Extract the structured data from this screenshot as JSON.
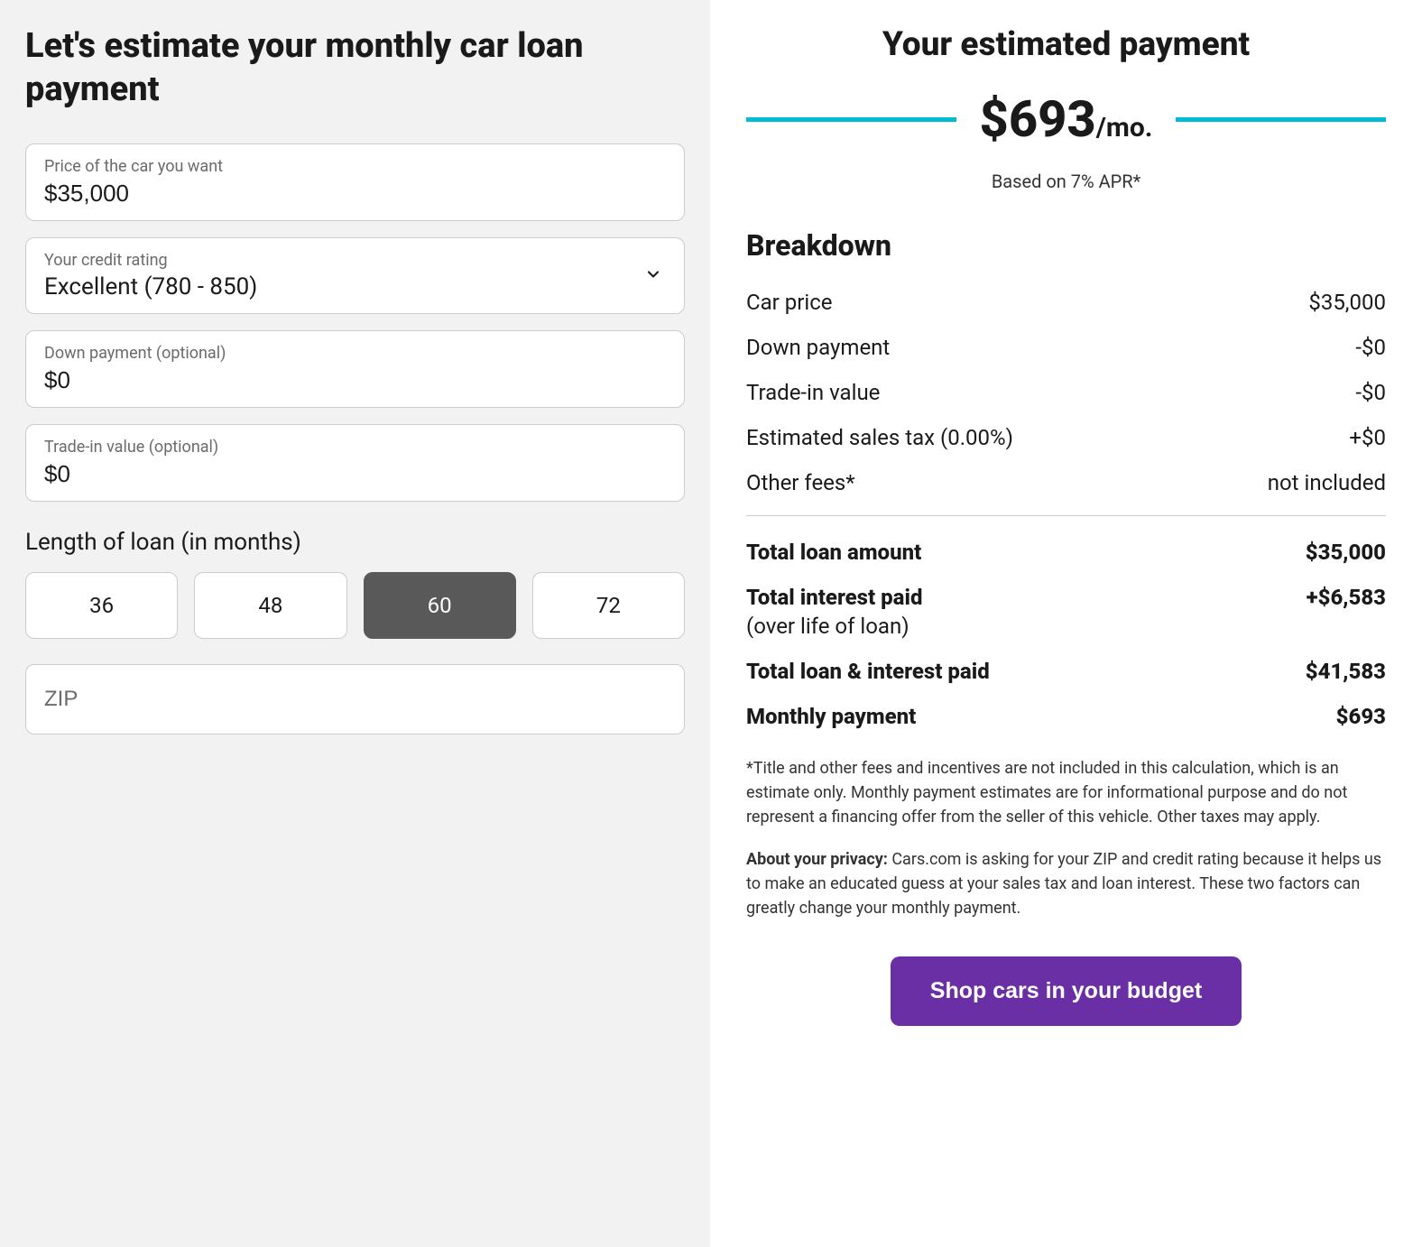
{
  "left": {
    "title": "Let's estimate your monthly car loan payment",
    "price_label": "Price of the car you want",
    "price_value": "$35,000",
    "credit_label": "Your credit rating",
    "credit_value": "Excellent (780 - 850)",
    "down_label": "Down payment (optional)",
    "down_value": "$0",
    "trade_label": "Trade-in value (optional)",
    "trade_value": "$0",
    "length_label": "Length of loan (in months)",
    "terms": [
      "36",
      "48",
      "60",
      "72"
    ],
    "term_selected": "60",
    "zip_placeholder": "ZIP"
  },
  "right": {
    "title": "Your estimated payment",
    "payment": "$693",
    "payment_suffix": "/mo.",
    "apr_text": "Based on 7% APR*",
    "breakdown_title": "Breakdown",
    "rows": {
      "car_price_label": "Car price",
      "car_price_value": "$35,000",
      "down_label": "Down payment",
      "down_value": "-$0",
      "trade_label": "Trade-in value",
      "trade_value": "-$0",
      "tax_label": "Estimated sales tax (0.00%)",
      "tax_value": "+$0",
      "fees_label": "Other fees*",
      "fees_value": "not included",
      "total_loan_label": "Total loan amount",
      "total_loan_value": "$35,000",
      "interest_label": "Total interest paid",
      "interest_sub": "(over life of loan)",
      "interest_value": "+$6,583",
      "total_paid_label": "Total loan & interest paid",
      "total_paid_value": "$41,583",
      "monthly_label": "Monthly payment",
      "monthly_value": "$693"
    },
    "disclaimer": "*Title and other fees and incentives are not included in this calculation, which is an estimate only. Monthly payment estimates are for informational purpose and do not represent a financing offer from the seller of this vehicle. Other taxes may apply.",
    "privacy_bold": "About your privacy: ",
    "privacy_text": "Cars.com is asking for your ZIP and credit rating because it helps us to make an educated guess at your sales tax and loan interest. These two factors can greatly change your monthly payment.",
    "cta": "Shop cars in your budget"
  }
}
